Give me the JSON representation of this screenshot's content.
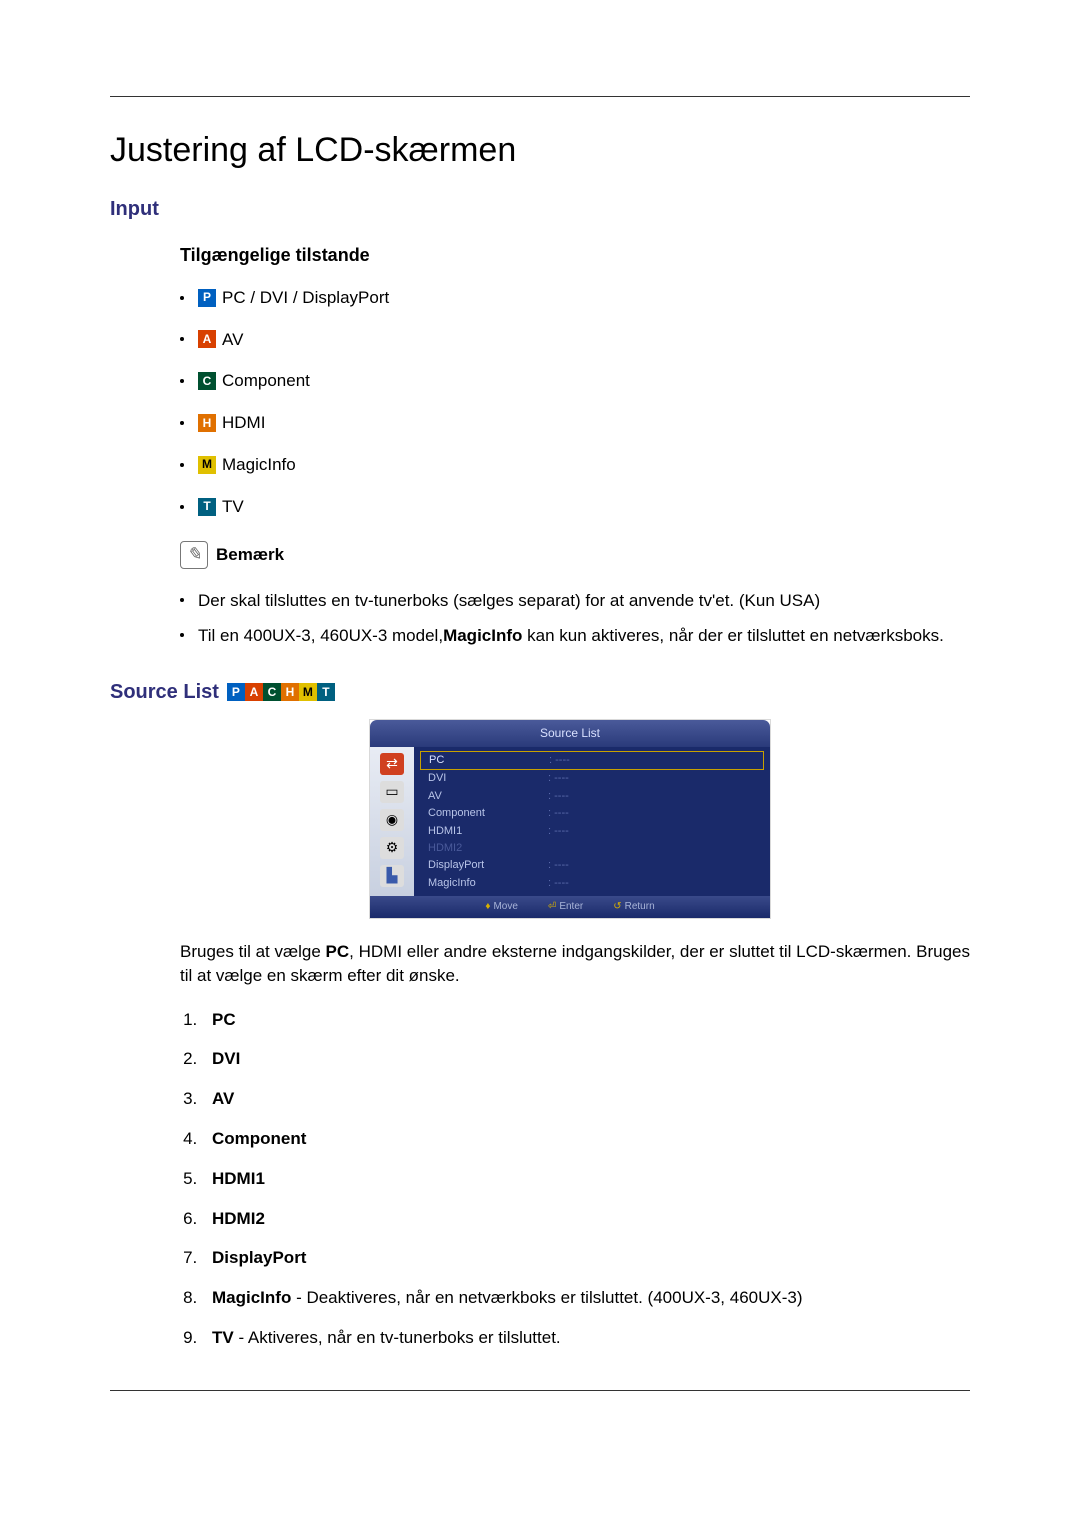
{
  "page_title": "Justering af LCD-skærmen",
  "input_heading": "Input",
  "modes_heading": "Tilgængelige tilstande",
  "modes": [
    {
      "letter": "P",
      "cls": "mi-P",
      "label": "PC / DVI / DisplayPort"
    },
    {
      "letter": "A",
      "cls": "mi-A",
      "label": "AV"
    },
    {
      "letter": "C",
      "cls": "mi-C",
      "label": "Component"
    },
    {
      "letter": "H",
      "cls": "mi-H",
      "label": "HDMI"
    },
    {
      "letter": "M",
      "cls": "mi-M",
      "label": "MagicInfo"
    },
    {
      "letter": "T",
      "cls": "mi-T",
      "label": "TV"
    }
  ],
  "note_label": "Bemærk",
  "notes": {
    "n1": "Der skal tilsluttes en tv-tunerboks (sælges separat) for at anvende tv'et. (Kun USA)",
    "n2_pre": "Til en 400UX-3, 460UX-3 model,",
    "n2_bold": "MagicInfo",
    "n2_post": " kan kun aktiveres, når der er tilsluttet en netværksboks."
  },
  "source_list_heading": "Source List",
  "source_strip": [
    "P",
    "A",
    "C",
    "H",
    "M",
    "T"
  ],
  "osd": {
    "title": "Source List",
    "rows": [
      {
        "label": "PC",
        "val": ": ----",
        "sel": true
      },
      {
        "label": "DVI",
        "val": ": ----"
      },
      {
        "label": "AV",
        "val": ": ----"
      },
      {
        "label": "Component",
        "val": ": ----"
      },
      {
        "label": "HDMI1",
        "val": ": ----"
      },
      {
        "label": "HDMI2",
        "val": "",
        "dim": true
      },
      {
        "label": "DisplayPort",
        "val": ": ----"
      },
      {
        "label": "MagicInfo",
        "val": ": ----"
      }
    ],
    "footer": {
      "move": "Move",
      "enter": "Enter",
      "ret": "Return"
    }
  },
  "usage": {
    "pre": "Bruges til at vælge ",
    "bold": "PC",
    "post": ", HDMI eller andre eksterne indgangskilder, der er sluttet til LCD-skærmen. Bruges til at vælge en skærm efter dit ønske."
  },
  "numbered": {
    "i1": "PC",
    "i2": "DVI",
    "i3": "AV",
    "i4": "Component",
    "i5": "HDMI1",
    "i6": "HDMI2",
    "i7": "DisplayPort",
    "i8_bold": "MagicInfo",
    "i8_rest": " - Deaktiveres, når en netværkboks er tilsluttet. (400UX-3, 460UX-3)",
    "i9_bold": "TV",
    "i9_rest": " - Aktiveres, når en tv-tunerboks er tilsluttet."
  }
}
